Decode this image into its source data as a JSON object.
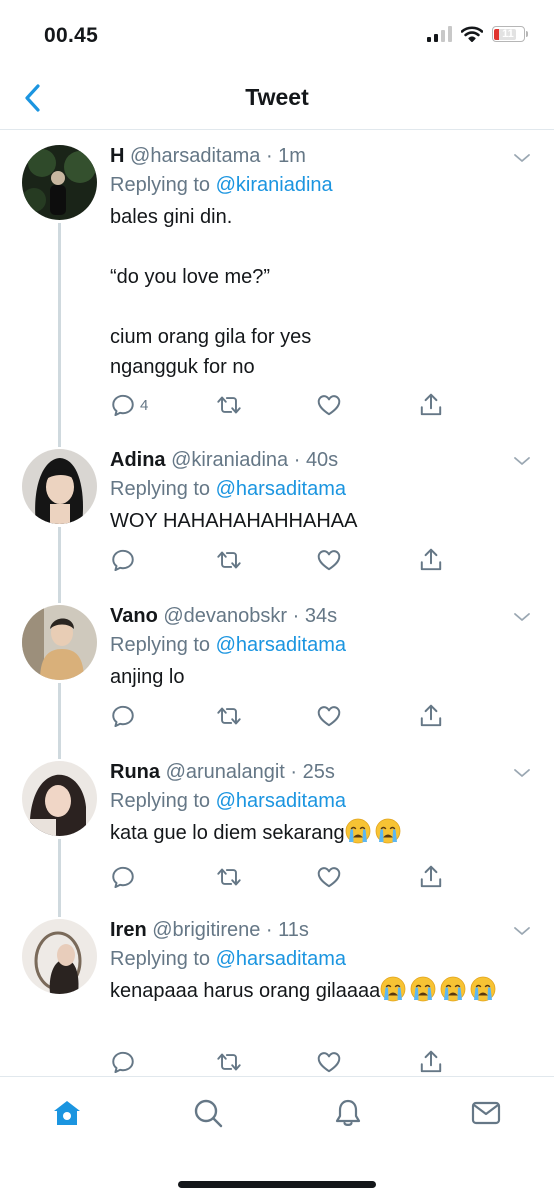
{
  "status_bar": {
    "time": "00.45",
    "battery_level": "11"
  },
  "nav": {
    "title": "Tweet"
  },
  "colors": {
    "accent": "#1b95e0",
    "secondary_text": "#657786",
    "divider": "#e1e8ed",
    "text": "#14171a"
  },
  "tweets": [
    {
      "name": "H",
      "handle": "@harsaditama",
      "dot": " · ",
      "time": "1m",
      "replying_prefix": "Replying to ",
      "replying_handle": "@kiraniadina",
      "text": "bales gini din.\n\n“do you love me?”\n\ncium orang gila for yes\nngangguk for no",
      "reply_count": "4"
    },
    {
      "name": "Adina",
      "handle": "@kiraniadina",
      "dot": " · ",
      "time": "40s",
      "replying_prefix": "Replying to ",
      "replying_handle": "@harsaditama",
      "text": "WOY HAHAHAHAHHAHAA",
      "reply_count": ""
    },
    {
      "name": "Vano",
      "handle": "@devanobskr",
      "dot": " · ",
      "time": "34s",
      "replying_prefix": "Replying to ",
      "replying_handle": "@harsaditama",
      "text": "anjing lo",
      "reply_count": ""
    },
    {
      "name": "Runa",
      "handle": "@arunalangit",
      "dot": " · ",
      "time": "25s",
      "replying_prefix": "Replying to ",
      "replying_handle": "@harsaditama",
      "text": "kata gue lo diem sekarang",
      "reply_count": ""
    },
    {
      "name": "Iren",
      "handle": "@brigitirene",
      "dot": " · ",
      "time": "11s",
      "replying_prefix": "Replying to ",
      "replying_handle": "@harsaditama",
      "text": "kenapaaa harus orang gilaaaa",
      "reply_count": ""
    }
  ],
  "tabs": [
    {
      "icon": "home-icon",
      "active": true
    },
    {
      "icon": "search-icon",
      "active": false
    },
    {
      "icon": "notifications-icon",
      "active": false
    },
    {
      "icon": "messages-icon",
      "active": false
    }
  ]
}
